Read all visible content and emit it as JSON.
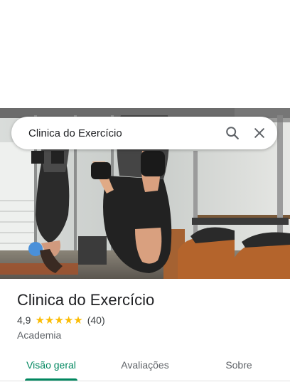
{
  "search": {
    "query": "Clinica do Exercício",
    "search_icon": "search-icon",
    "close_icon": "close-icon"
  },
  "place": {
    "name": "Clinica do Exercício",
    "rating": "4,9",
    "stars": 5,
    "review_count": "(40)",
    "category": "Academia"
  },
  "tabs": [
    {
      "label": "Visão geral",
      "active": true
    },
    {
      "label": "Avaliações",
      "active": false
    },
    {
      "label": "Sobre",
      "active": false
    }
  ],
  "colors": {
    "accent": "#01875f",
    "star": "#fbbc04"
  }
}
